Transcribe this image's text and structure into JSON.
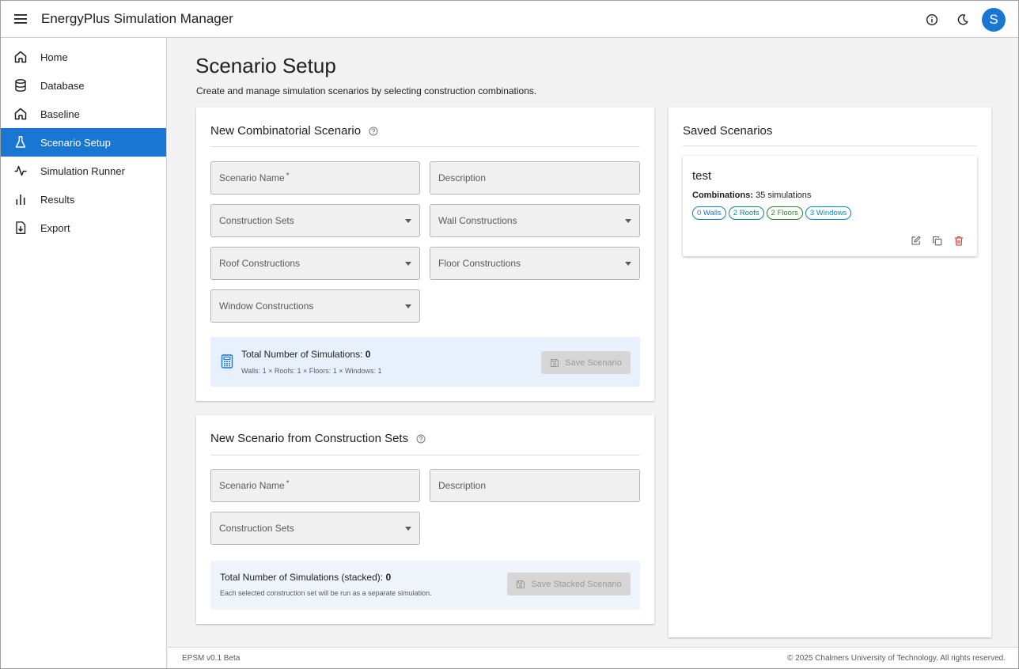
{
  "app": {
    "title": "EnergyPlus Simulation Manager",
    "avatar_letter": "S"
  },
  "sidebar": {
    "items": [
      {
        "label": "Home",
        "icon": "home-icon"
      },
      {
        "label": "Database",
        "icon": "database-icon"
      },
      {
        "label": "Baseline",
        "icon": "home-outline-icon"
      },
      {
        "label": "Scenario Setup",
        "icon": "flask-icon",
        "active": true
      },
      {
        "label": "Simulation Runner",
        "icon": "activity-icon"
      },
      {
        "label": "Results",
        "icon": "bar-chart-icon"
      },
      {
        "label": "Export",
        "icon": "file-download-icon"
      }
    ]
  },
  "page": {
    "title": "Scenario Setup",
    "subtitle": "Create and manage simulation scenarios by selecting construction combinations."
  },
  "combinatorial": {
    "title": "New Combinatorial Scenario",
    "name_label": "Scenario Name",
    "required_mark": "*",
    "description_label": "Description",
    "construction_sets_label": "Construction Sets",
    "wall_label": "Wall Constructions",
    "roof_label": "Roof Constructions",
    "floor_label": "Floor Constructions",
    "window_label": "Window Constructions",
    "total_label": "Total Number of Simulations:",
    "total_value": "0",
    "breakdown": "Walls: 1 × Roofs: 1 × Floors: 1 × Windows: 1",
    "save_label": "Save Scenario"
  },
  "from_sets": {
    "title": "New Scenario from Construction Sets",
    "name_label": "Scenario Name",
    "required_mark": "*",
    "description_label": "Description",
    "construction_sets_label": "Construction Sets",
    "total_label": "Total Number of Simulations (stacked):",
    "total_value": "0",
    "note": "Each selected construction set will be run as a separate simulation.",
    "save_label": "Save Stacked Scenario"
  },
  "saved": {
    "title": "Saved Scenarios",
    "scenarios": [
      {
        "name": "test",
        "combinations_label": "Combinations:",
        "combinations_value": "35 simulations",
        "chips": [
          {
            "label": "0 Walls",
            "color": "#1976d2"
          },
          {
            "label": "2 Roofs",
            "color": "#00897b"
          },
          {
            "label": "2 Floors",
            "color": "#2e7d32"
          },
          {
            "label": "3 Windows",
            "color": "#0288d1"
          }
        ]
      }
    ]
  },
  "footer": {
    "version": "EPSM v0.1 Beta",
    "copyright": "© 2025 Chalmers University of Technology. All rights reserved."
  },
  "colors": {
    "primary": "#1976d2",
    "danger": "#d32f2f"
  }
}
